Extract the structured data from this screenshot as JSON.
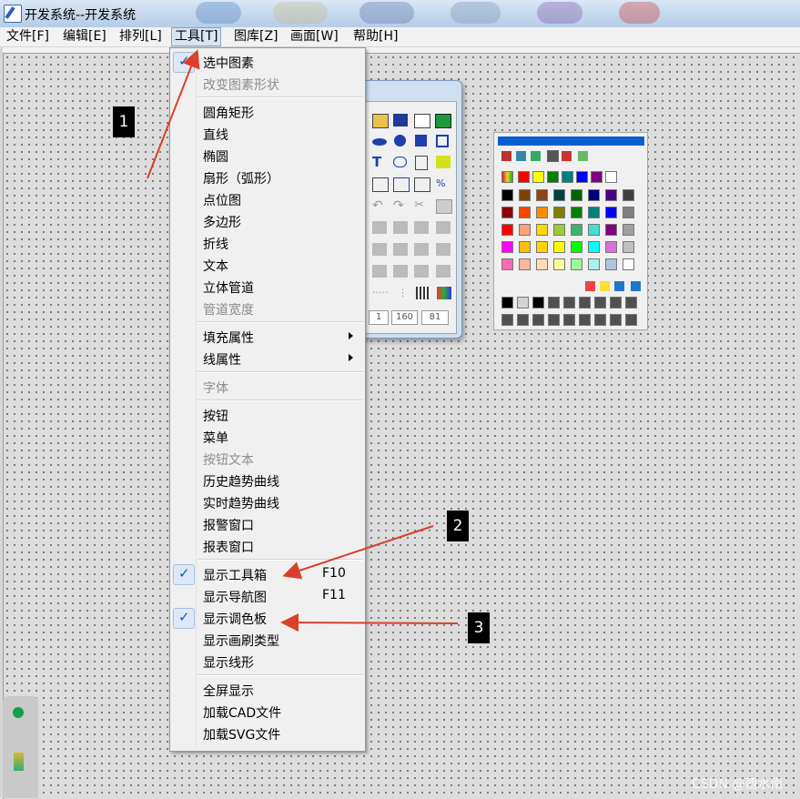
{
  "window": {
    "title": "开发系统--开发系统"
  },
  "menubar": {
    "items": [
      "文件[F]",
      "编辑[E]",
      "排列[L]",
      "工具[T]",
      "图库[Z]",
      "画面[W]",
      "帮助[H]"
    ]
  },
  "tools_menu": {
    "items": [
      {
        "label": "选中图素",
        "checked": true
      },
      {
        "label": "改变图素形状",
        "disabled": true
      },
      {
        "sep": true
      },
      {
        "label": "圆角矩形"
      },
      {
        "label": "直线"
      },
      {
        "label": "椭圆"
      },
      {
        "label": "扇形（弧形）"
      },
      {
        "label": "点位图"
      },
      {
        "label": "多边形"
      },
      {
        "label": "折线"
      },
      {
        "label": "文本"
      },
      {
        "label": "立体管道"
      },
      {
        "label": "管道宽度",
        "disabled": true
      },
      {
        "sep": true
      },
      {
        "label": "填充属性",
        "submenu": true
      },
      {
        "label": "线属性",
        "submenu": true
      },
      {
        "sep": true
      },
      {
        "label": "字体",
        "disabled": true
      },
      {
        "sep": true
      },
      {
        "label": "按钮"
      },
      {
        "label": "菜单"
      },
      {
        "label": "按钮文本",
        "disabled": true
      },
      {
        "label": "历史趋势曲线"
      },
      {
        "label": "实时趋势曲线"
      },
      {
        "label": "报警窗口"
      },
      {
        "label": "报表窗口"
      },
      {
        "sep": true
      },
      {
        "label": "显示工具箱",
        "checked": true,
        "shortcut": "F10"
      },
      {
        "label": "显示导航图",
        "shortcut": "F11"
      },
      {
        "label": "显示调色板",
        "checked": true
      },
      {
        "label": "显示画刷类型"
      },
      {
        "label": "显示线形"
      },
      {
        "sep": true
      },
      {
        "label": "全屏显示"
      },
      {
        "label": "加载CAD文件"
      },
      {
        "label": "加载SVG文件"
      }
    ]
  },
  "toolbox": {
    "fields": [
      "1",
      "160",
      "81"
    ]
  },
  "palette": {
    "swatch_rows": [
      [
        "#000000",
        "#804000",
        "#8b4513",
        "#004040",
        "#006400",
        "#000080",
        "#4b0082",
        "#404040"
      ],
      [
        "#8b0000",
        "#ff4500",
        "#ff8c00",
        "#808000",
        "#008000",
        "#008080",
        "#0000ff",
        "#808080"
      ],
      [
        "#ff0000",
        "#ffa07a",
        "#ffd700",
        "#9acd32",
        "#3cb371",
        "#40e0d0",
        "#800080",
        "#a0a0a0"
      ],
      [
        "#ff00ff",
        "#ffc000",
        "#ffd700",
        "#ffff00",
        "#00ff00",
        "#00ffff",
        "#da70d6",
        "#c0c0c0"
      ],
      [
        "#ff69b4",
        "#ffb6a0",
        "#ffdab9",
        "#ffff99",
        "#98fb98",
        "#afeeee",
        "#b0c4de",
        "#ffffff"
      ]
    ],
    "top_row": [
      "#ff0000",
      "#ffff00",
      "#008000",
      "#008080",
      "#0000ff",
      "#800080",
      "#ffffff"
    ]
  },
  "annotations": {
    "badge1": "1",
    "badge2": "2",
    "badge3": "3"
  },
  "watermark": "CSDN @酉水南",
  "colors": {
    "arrow": "#d9402a",
    "menu_accent": "#1c56b8"
  }
}
